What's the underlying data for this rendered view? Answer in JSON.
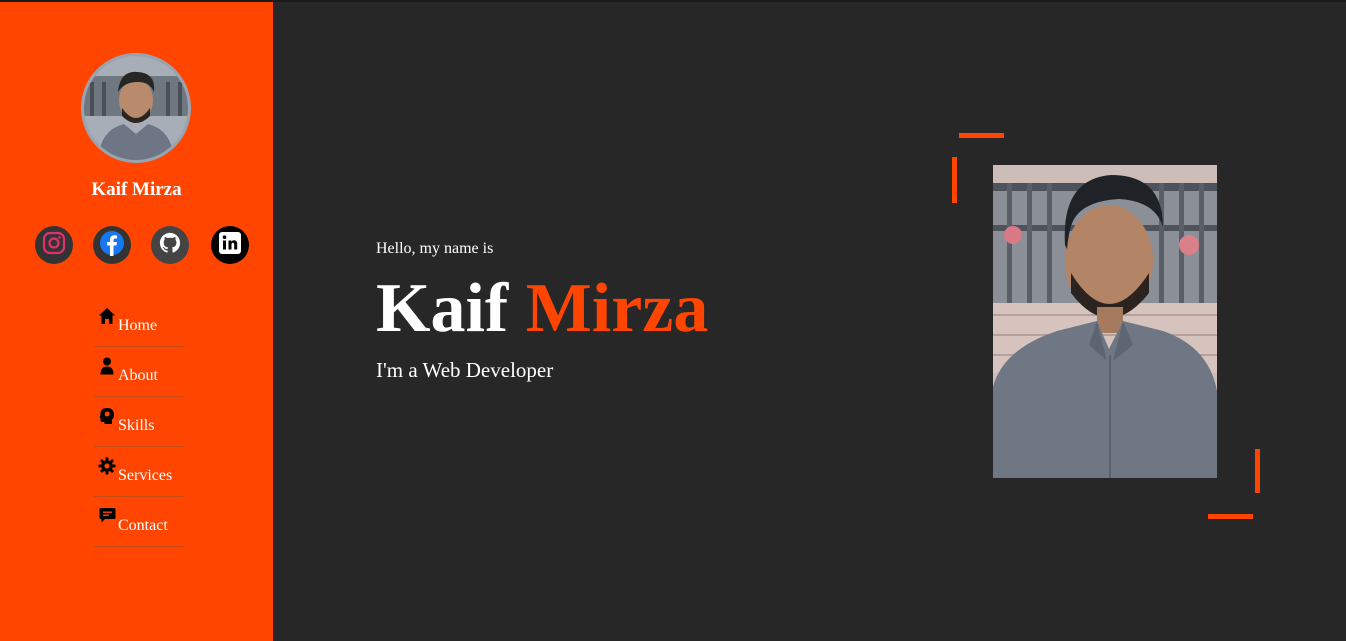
{
  "sidebar": {
    "profile_name": "Kaif Mirza",
    "socials": [
      {
        "name": "instagram",
        "icon": "instagram-icon"
      },
      {
        "name": "facebook",
        "icon": "facebook-icon"
      },
      {
        "name": "github",
        "icon": "github-icon"
      },
      {
        "name": "linkedin",
        "icon": "linkedin-icon"
      }
    ],
    "nav": [
      {
        "label": "Home",
        "icon": "home-icon"
      },
      {
        "label": "About",
        "icon": "user-icon"
      },
      {
        "label": "Skills",
        "icon": "head-bulb-icon"
      },
      {
        "label": "Services",
        "icon": "gear-icon"
      },
      {
        "label": "Contact",
        "icon": "chat-icon"
      }
    ]
  },
  "hero": {
    "greeting": "Hello, my name is",
    "first_name": "Kaif",
    "last_name": "Mirza",
    "role": "I'm a Web Developer"
  },
  "colors": {
    "accent": "#ff4500",
    "background": "#272727",
    "text": "#ffffff"
  }
}
